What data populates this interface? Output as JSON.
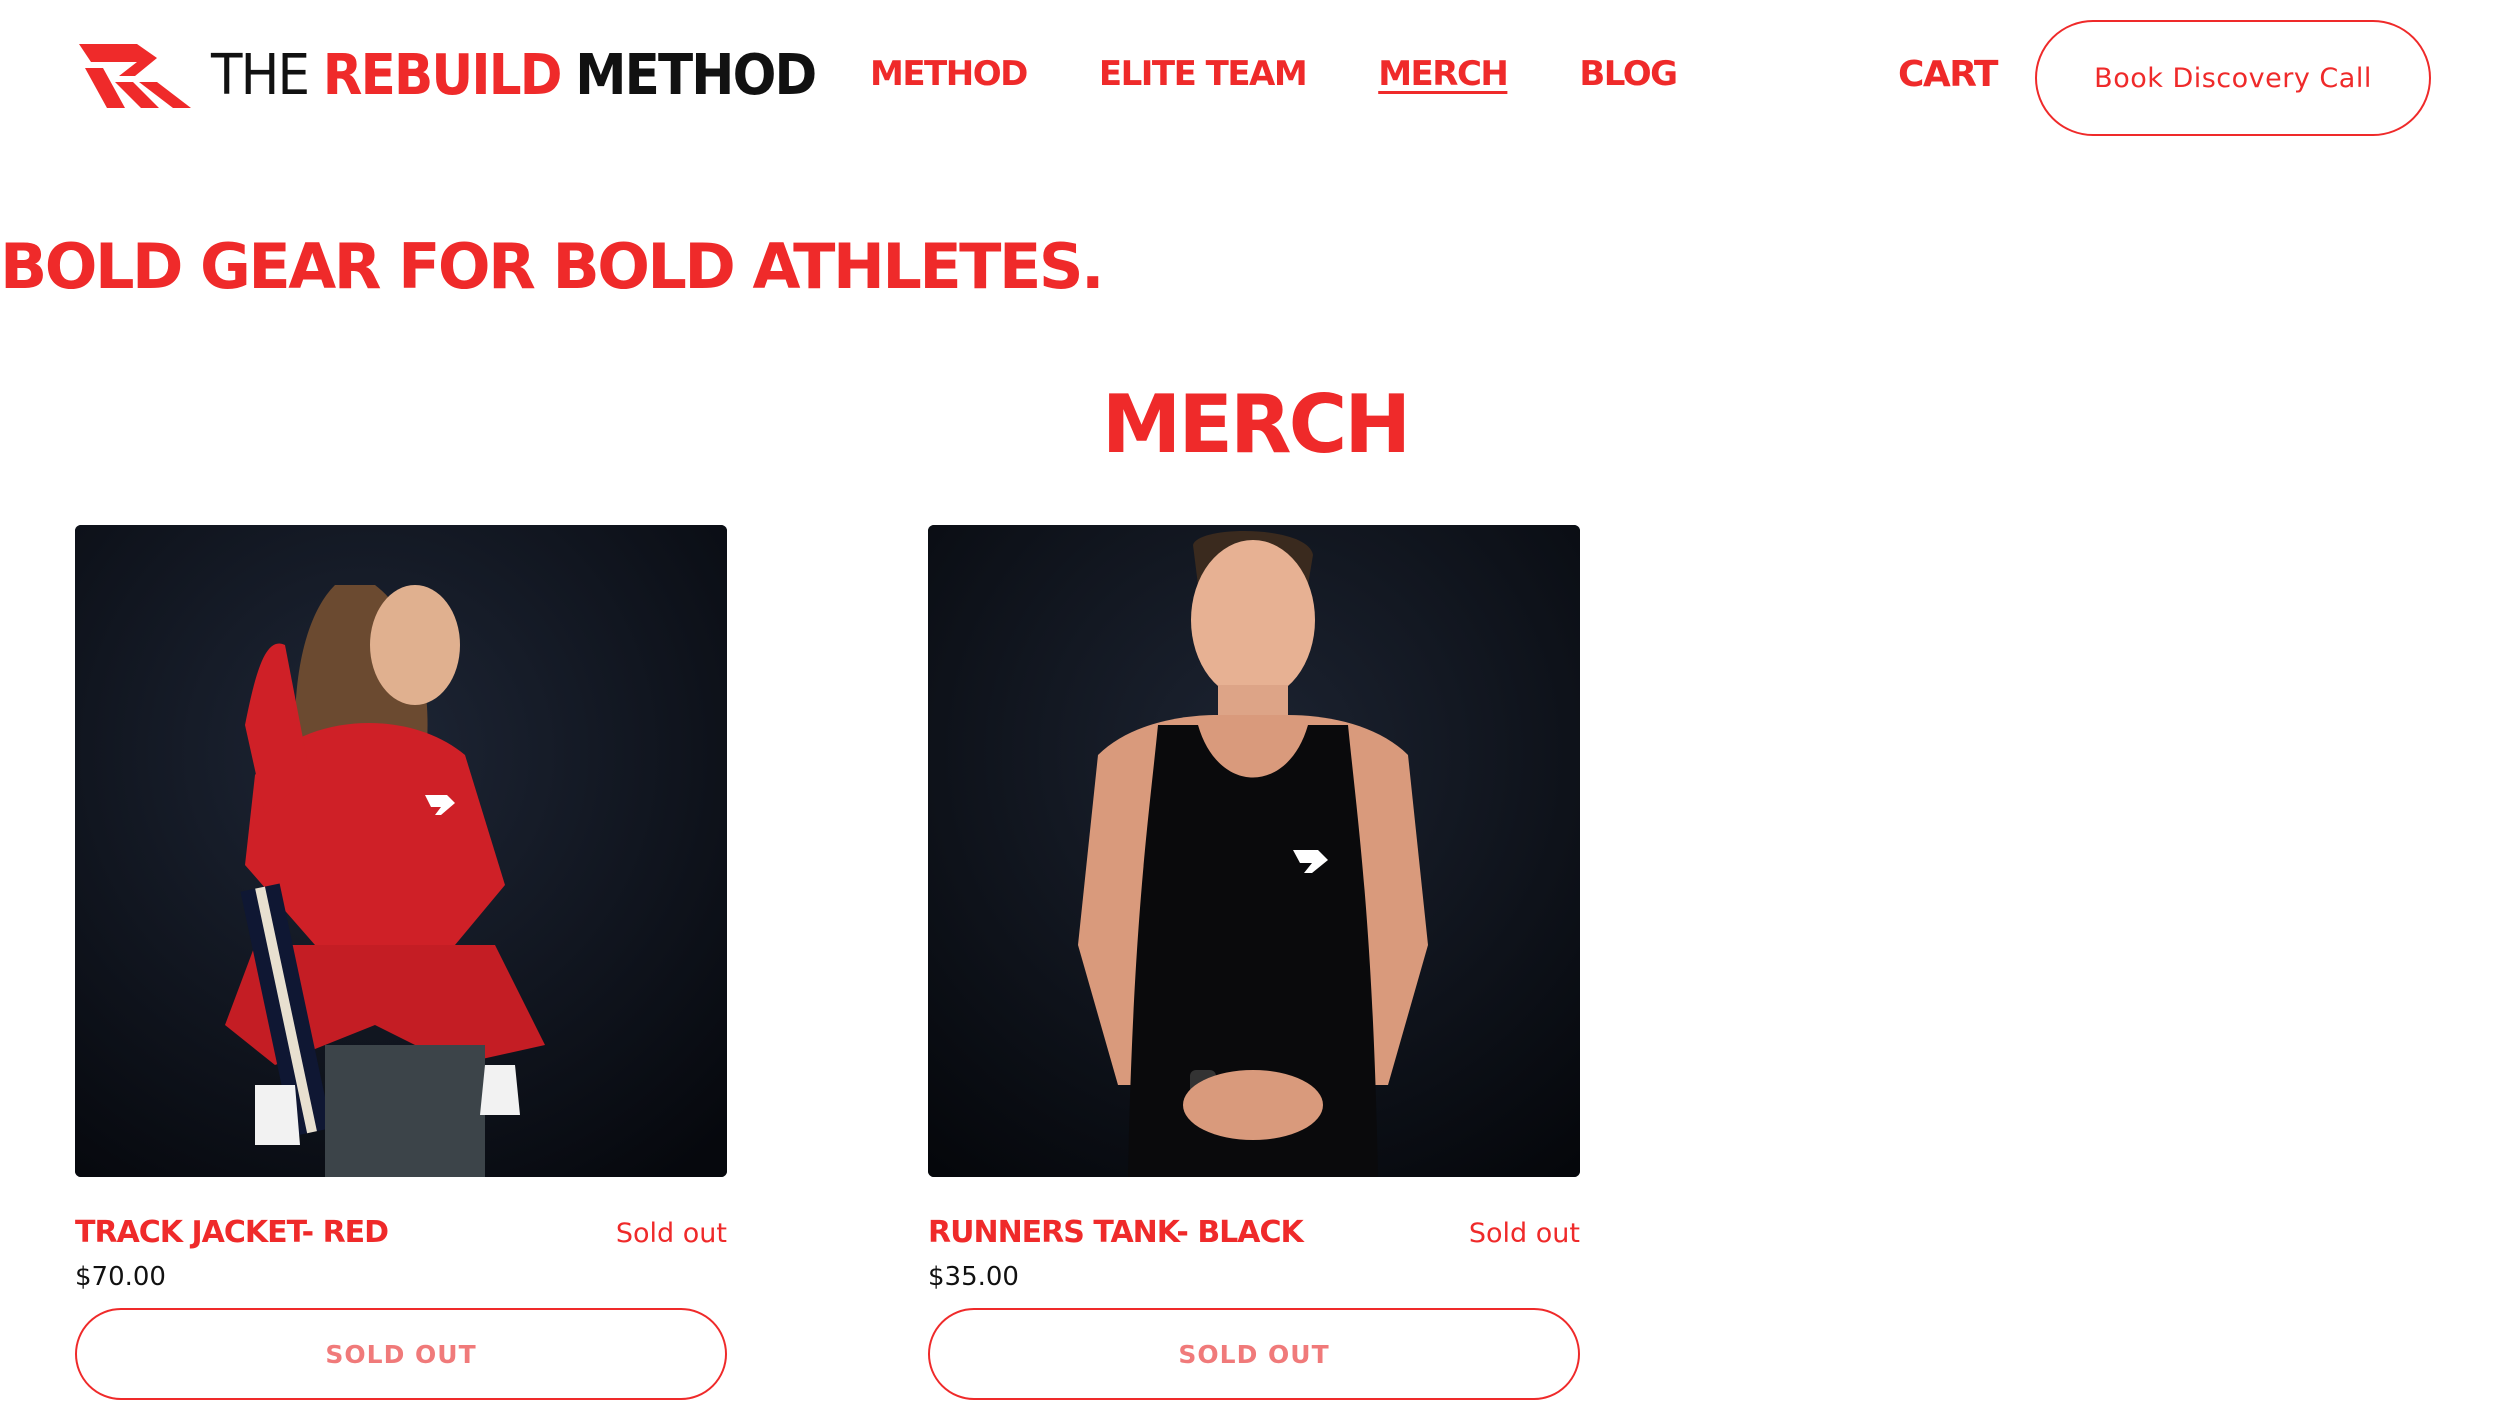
{
  "brand": {
    "word1": "THE",
    "word2": "REBUILD",
    "word3": "METHOD",
    "accent_color": "#ef2a2a"
  },
  "nav": {
    "items": [
      {
        "label": "METHOD"
      },
      {
        "label": "ELITE TEAM"
      },
      {
        "label": "MERCH"
      },
      {
        "label": "BLOG"
      }
    ],
    "active": "MERCH"
  },
  "header": {
    "cart_label": "CART",
    "cta_label": "Book Discovery Call"
  },
  "page": {
    "tagline": "BOLD GEAR FOR BOLD ATHLETES.",
    "section_title": "MERCH"
  },
  "products": [
    {
      "name": "TRACK JACKET- RED",
      "status": "Sold out",
      "price": "$70.00",
      "button_label": "SOLD OUT"
    },
    {
      "name": "RUNNERS TANK- BLACK",
      "status": "Sold out",
      "price": "$35.00",
      "button_label": "SOLD OUT"
    }
  ]
}
